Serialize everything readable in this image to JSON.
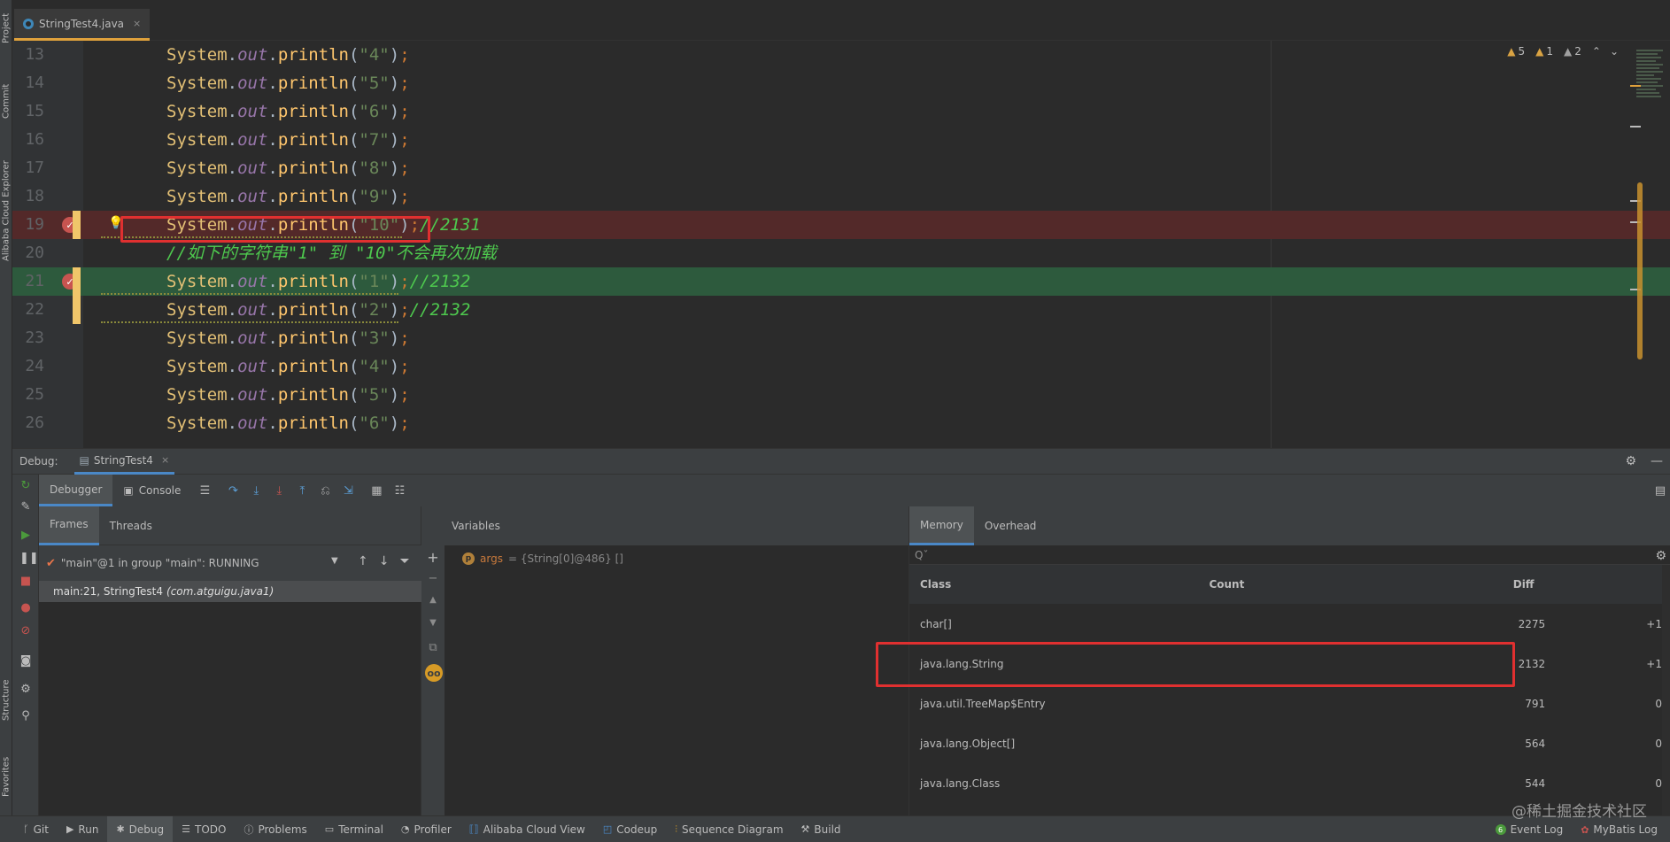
{
  "left_strip": {
    "tabs": [
      "Project",
      "Commit",
      "Alibaba Cloud Explorer",
      "Structure",
      "Favorites"
    ]
  },
  "editor_tab": {
    "label": "StringTest4.java",
    "close": "×"
  },
  "editor": {
    "lines": [
      {
        "no": "13",
        "str": "\"4\"",
        "comment": ""
      },
      {
        "no": "14",
        "str": "\"5\"",
        "comment": ""
      },
      {
        "no": "15",
        "str": "\"6\"",
        "comment": ""
      },
      {
        "no": "16",
        "str": "\"7\"",
        "comment": ""
      },
      {
        "no": "17",
        "str": "\"8\"",
        "comment": ""
      },
      {
        "no": "18",
        "str": "\"9\"",
        "comment": ""
      },
      {
        "no": "19",
        "str": "\"10\"",
        "comment": "//2131"
      },
      {
        "no": "20",
        "str": "",
        "comment": "//如下的字符串\"1\" 到 \"10\"不会再次加载"
      },
      {
        "no": "21",
        "str": "\"1\"",
        "comment": "//2132"
      },
      {
        "no": "22",
        "str": "\"2\"",
        "comment": "//2132"
      },
      {
        "no": "23",
        "str": "\"3\"",
        "comment": ""
      },
      {
        "no": "24",
        "str": "\"4\"",
        "comment": ""
      },
      {
        "no": "25",
        "str": "\"5\"",
        "comment": ""
      },
      {
        "no": "26",
        "str": "\"6\"",
        "comment": ""
      }
    ],
    "code_prefix": {
      "cls": "System",
      "dot1": ".",
      "field": "out",
      "dot2": ".",
      "method": "println",
      "open": "(",
      "close": ")",
      "semi": ";"
    },
    "warnings": {
      "w1": "5",
      "w2": "1",
      "w3": "2"
    }
  },
  "debug": {
    "label": "Debug:",
    "session_tab": "StringTest4",
    "tabs": {
      "debugger": "Debugger",
      "console": "Console"
    },
    "frames": {
      "tab_frames": "Frames",
      "tab_threads": "Threads",
      "thread": "\"main\"@1 in group \"main\": RUNNING",
      "frame_loc": "main:21, StringTest4",
      "frame_pkg": "(com.atguigu.java1)"
    },
    "variables": {
      "title": "Variables",
      "var_name": "args",
      "var_value": "= {String[0]@486} []"
    },
    "memory": {
      "tab_memory": "Memory",
      "tab_overhead": "Overhead",
      "search_placeholder": "Qˇ",
      "headers": {
        "class": "Class",
        "count": "Count",
        "diff": "Diff"
      },
      "rows": [
        {
          "cls": "char[]",
          "count": "2275",
          "diff": "+1"
        },
        {
          "cls": "java.lang.String",
          "count": "2132",
          "diff": "+1"
        },
        {
          "cls": "java.util.TreeMap$Entry",
          "count": "791",
          "diff": "0"
        },
        {
          "cls": "java.lang.Object[]",
          "count": "564",
          "diff": "0"
        },
        {
          "cls": "java.lang.Class",
          "count": "544",
          "diff": "0"
        }
      ]
    }
  },
  "status_bar": {
    "items": [
      "Git",
      "Run",
      "Debug",
      "TODO",
      "Problems",
      "Terminal",
      "Profiler",
      "Alibaba Cloud View",
      "Codeup",
      "Sequence Diagram",
      "Build"
    ],
    "event_log": "Event Log",
    "event_count": "6",
    "mybatis": "MyBatis Log"
  },
  "watermark": "@稀土掘金技术社区"
}
